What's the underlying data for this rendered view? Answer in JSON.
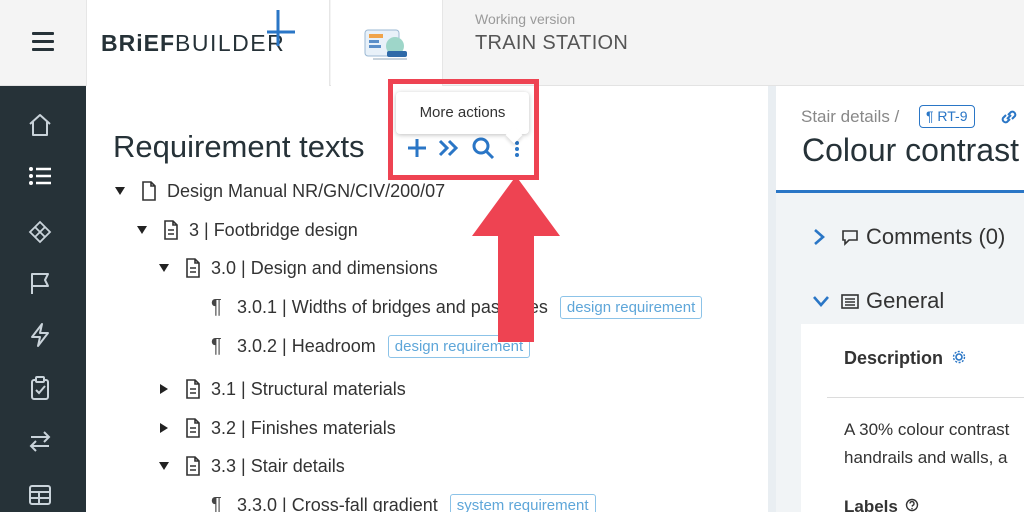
{
  "header": {
    "brand_bold": "BRiEF",
    "brand_light": "BUILDER",
    "working_version_label": "Working version",
    "project_title": "TRAIN STATION",
    "accent_color": "#2a76c6"
  },
  "nav": {
    "items": [
      "home-icon",
      "list-icon",
      "components-icon",
      "flag-icon",
      "lightning-icon",
      "clipboard-check-icon",
      "arrows-swap-icon",
      "table-icon"
    ],
    "background_color": "#263238"
  },
  "panel": {
    "title": "Requirement texts",
    "toolbar": [
      "plus-icon",
      "double-chevron-icon",
      "search-icon",
      "more-vertical-icon"
    ],
    "tooltip": "More actions"
  },
  "tree": {
    "root": "Design Manual NR/GN/CIV/200/07",
    "chapter_3": "3 | Footbridge design",
    "section_30": "3.0 | Design and dimensions",
    "req_301": "3.0.1 | Widths of bridges and passages",
    "req_301_tag": "design requirement",
    "req_302": "3.0.2 | Headroom",
    "req_302_tag": "design requirement",
    "section_31": "3.1 | Structural materials",
    "section_32": "3.2 | Finishes materials",
    "section_33": "3.3 | Stair details",
    "req_330": "3.3.0 | Cross-fall gradient",
    "req_330_tag": "system requirement"
  },
  "details": {
    "breadcrumb": "Stair details /",
    "ref_tag": "RT-9",
    "title": "Colour contrast",
    "comments": "Comments (0)",
    "general": "General",
    "description_label": "Description",
    "description_line1": "A 30% colour contrast",
    "description_line2": "handrails and walls, a",
    "labels_label": "Labels"
  },
  "annotation": {
    "highlight_color": "#ee4352"
  }
}
